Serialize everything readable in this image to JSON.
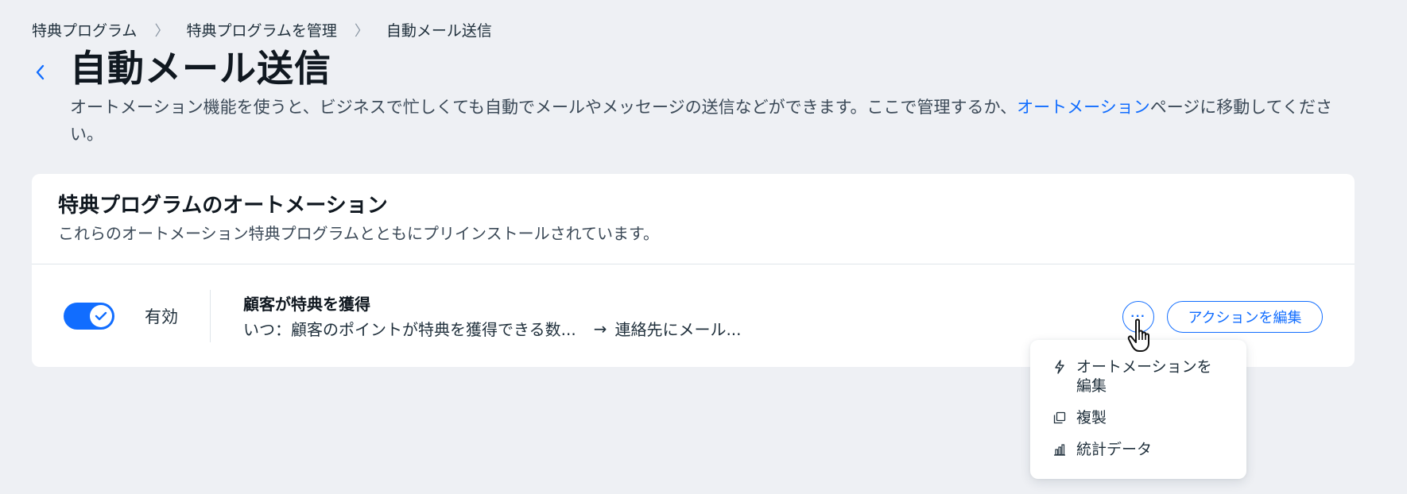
{
  "breadcrumb": {
    "items": [
      "特典プログラム",
      "特典プログラムを管理",
      "自動メール送信"
    ],
    "separator": "〉"
  },
  "header": {
    "back_icon": "chevron-left-icon",
    "title": "自動メール送信",
    "description_before": "オートメーション機能を使うと、ビジネスで忙しくても自動でメールやメッセージの送信などができます。ここで管理するか、",
    "description_link": "オートメーション",
    "description_after": "ページに移動してください。"
  },
  "card": {
    "title": "特典プログラムのオートメーション",
    "subtitle": "これらのオートメーション特典プログラムとともにプリインストールされています。",
    "automation": {
      "enabled": true,
      "status_label": "有効",
      "name": "顧客が特典を獲得",
      "trigger": "いつ：顧客のポイントが特典を獲得できる数...",
      "arrow": "→",
      "action": "連絡先にメール...",
      "more_label": "···",
      "edit_label": "アクションを編集"
    }
  },
  "menu": {
    "items": [
      {
        "icon": "lightning-icon",
        "label": "オートメーションを編集"
      },
      {
        "icon": "duplicate-icon",
        "label": "複製"
      },
      {
        "icon": "bar-chart-icon",
        "label": "統計データ"
      }
    ]
  },
  "colors": {
    "accent": "#116dff",
    "background": "#eef0f4",
    "card": "#ffffff",
    "title_text": "#101820"
  }
}
